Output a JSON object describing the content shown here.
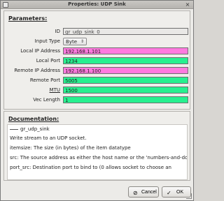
{
  "window": {
    "title": "Properties: UDP Sink",
    "close_symbol": "×"
  },
  "parameters": {
    "heading": "Parameters:",
    "fields": [
      {
        "label": "ID",
        "value": "gr_udp_sink_0",
        "style": "readonly",
        "type": "text"
      },
      {
        "label": "Input Type",
        "value": "Byte",
        "style": "combo",
        "type": "select"
      },
      {
        "label": "Local IP Address",
        "value": "192.168.1.101",
        "style": "magenta",
        "type": "text"
      },
      {
        "label": "Local Port",
        "value": "1234",
        "style": "green",
        "type": "text"
      },
      {
        "label": "Remote IP Address",
        "value": "192.168.1.100",
        "style": "magenta",
        "type": "text"
      },
      {
        "label": "Remote Port",
        "value": "5005",
        "style": "green",
        "type": "text"
      },
      {
        "label": "MTU",
        "value": "1500",
        "style": "green",
        "type": "text"
      },
      {
        "label": "Vec Length",
        "value": "1",
        "style": "green",
        "type": "text"
      }
    ]
  },
  "documentation": {
    "heading": "Documentation:",
    "block_name": "gr_udp_sink",
    "lines": [
      "Write stream to an UDP socket.",
      "itemsize: The size (in bytes) of the item datatype",
      "src: The source address as either the host name or the 'numbers-and-dots' IP address",
      "port_src: Destination port to bind to (0 allows socket to choose an"
    ]
  },
  "buttons": {
    "cancel": {
      "label": "Cancel",
      "icon": "cancel-icon",
      "glyph": "⊘"
    },
    "ok": {
      "label": "OK",
      "icon": "ok-icon",
      "glyph": "✓"
    }
  },
  "colors": {
    "ip_field": "#ff7adf",
    "value_field": "#27f08f",
    "readonly_field": "#e9e8e6"
  }
}
